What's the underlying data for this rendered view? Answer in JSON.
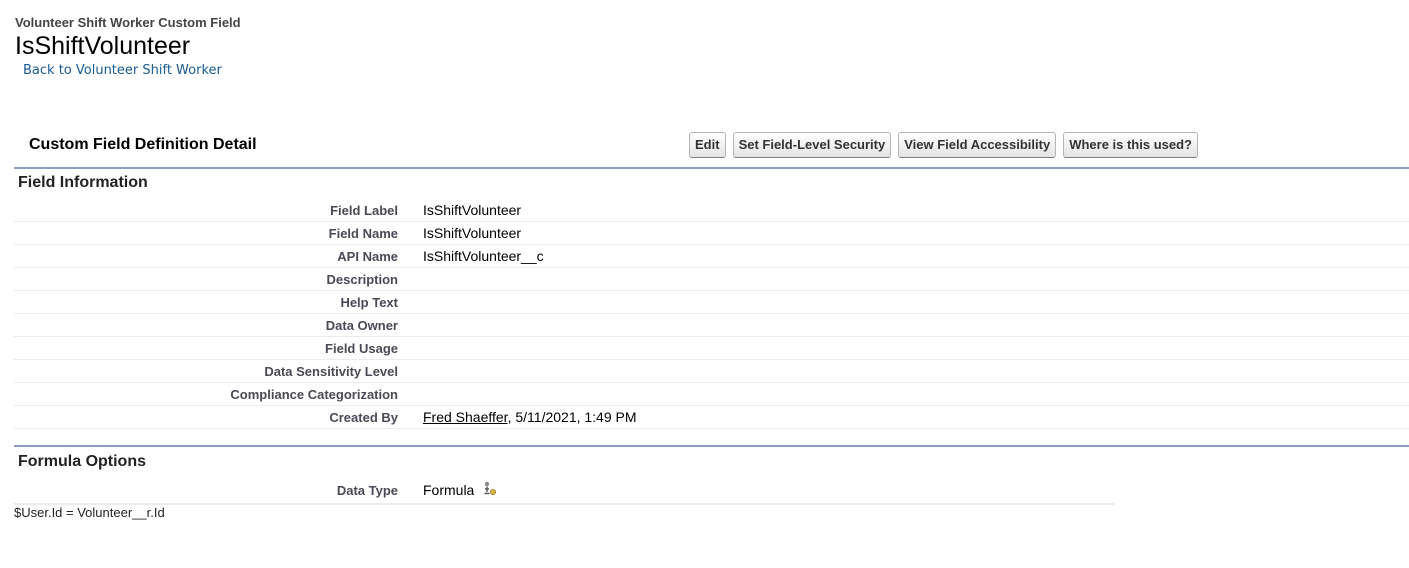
{
  "header": {
    "object_type": "Volunteer Shift Worker Custom Field",
    "title": "IsShiftVolunteer",
    "back_link": "Back to Volunteer Shift Worker"
  },
  "detail": {
    "section_title": "Custom Field Definition Detail",
    "buttons": {
      "edit": "Edit",
      "fls": "Set Field-Level Security",
      "accessibility": "View Field Accessibility",
      "where_used": "Where is this used?"
    }
  },
  "field_information": {
    "title": "Field Information",
    "rows": [
      {
        "label": "Field Label",
        "value": "IsShiftVolunteer"
      },
      {
        "label": "Field Name",
        "value": "IsShiftVolunteer"
      },
      {
        "label": "API Name",
        "value": "IsShiftVolunteer__c"
      },
      {
        "label": "Description",
        "value": ""
      },
      {
        "label": "Help Text",
        "value": ""
      },
      {
        "label": "Data Owner",
        "value": ""
      },
      {
        "label": "Field Usage",
        "value": ""
      },
      {
        "label": "Data Sensitivity Level",
        "value": ""
      },
      {
        "label": "Compliance Categorization",
        "value": ""
      }
    ],
    "created_by": {
      "label": "Created By",
      "user": "Fred Shaeffer",
      "date": ", 5/11/2021, 1:49 PM"
    }
  },
  "formula_options": {
    "title": "Formula Options",
    "data_type_label": "Data Type",
    "data_type_value": "Formula",
    "data_type_icon": "formula-info-icon",
    "formula": "$User.Id = Volunteer__r.Id"
  }
}
